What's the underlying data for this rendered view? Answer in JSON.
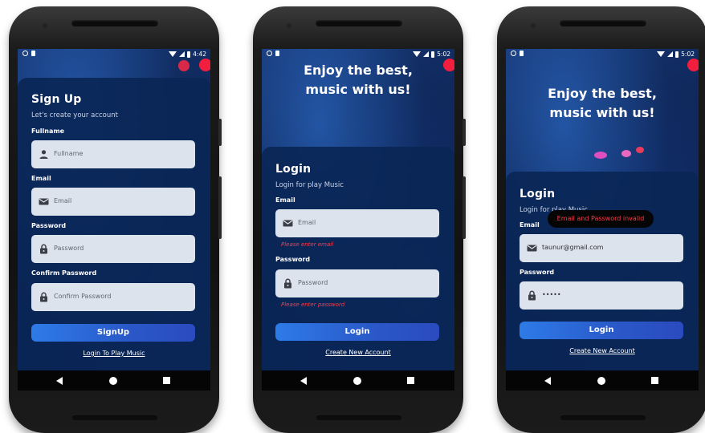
{
  "phones": [
    {
      "status_time": "4:42",
      "title": "Sign Up",
      "subtitle": "Let's create your account",
      "fields": [
        {
          "label": "Fullname",
          "placeholder": "Fullname"
        },
        {
          "label": "Email",
          "placeholder": "Email"
        },
        {
          "label": "Password",
          "placeholder": "Password"
        },
        {
          "label": "Confirm Password",
          "placeholder": "Confirm Password"
        }
      ],
      "button": "SignUp",
      "link": "Login To Play Music"
    },
    {
      "status_time": "5:02",
      "hero": [
        "Enjoy the best,",
        "music with us!"
      ],
      "title": "Login",
      "subtitle": "Login for play Music",
      "fields": [
        {
          "label": "Email",
          "placeholder": "Email",
          "error": "Please enter email"
        },
        {
          "label": "Password",
          "placeholder": "Password",
          "error": "Please enter password"
        }
      ],
      "button": "Login",
      "link": "Create New Account"
    },
    {
      "status_time": "5:02",
      "hero": [
        "Enjoy the best,",
        "music with us!"
      ],
      "title": "Login",
      "subtitle": "Login for play Music",
      "toast": "Email and Password invalid",
      "fields": [
        {
          "label": "Email",
          "value": "taunur@gmail.com"
        },
        {
          "label": "Password",
          "value": "•••••"
        }
      ],
      "button": "Login",
      "link": "Create New Account"
    }
  ],
  "colors": {
    "accent": "#2d7be8",
    "error": "#ff3b45",
    "card": "#0a2656",
    "field": "#dde3ec"
  },
  "icons": [
    "person-icon",
    "mail-icon",
    "lock-icon",
    "back-icon",
    "home-icon",
    "recent-apps-icon",
    "wifi-icon",
    "signal-icon",
    "battery-icon"
  ]
}
